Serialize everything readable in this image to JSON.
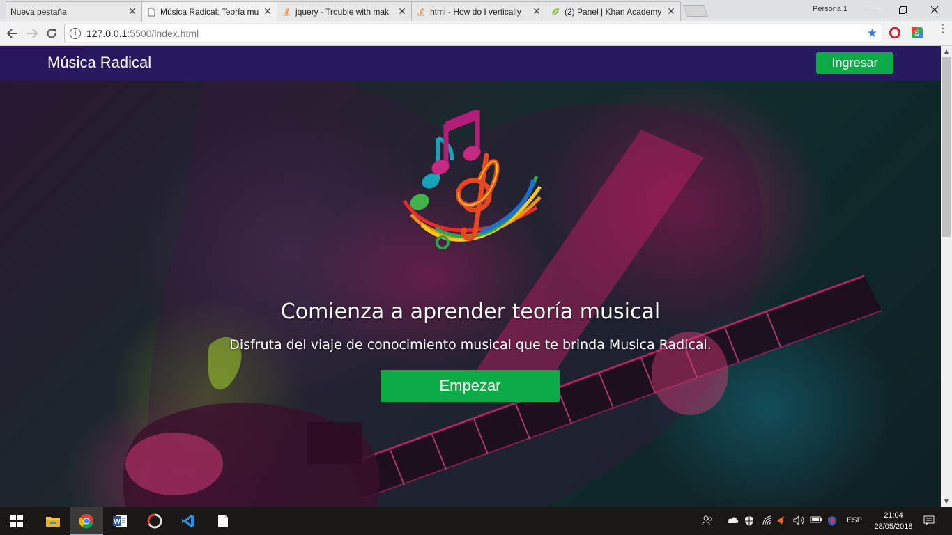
{
  "browser": {
    "tabs": [
      {
        "label": "Nueva pestaña",
        "favicon": "none"
      },
      {
        "label": "Música Radical: Teoría mu",
        "favicon": "page-icon"
      },
      {
        "label": "jquery - Trouble with mak",
        "favicon": "stackoverflow-icon"
      },
      {
        "label": "html - How do I vertically",
        "favicon": "stackoverflow-icon"
      },
      {
        "label": "(2) Panel | Khan Academy",
        "favicon": "khan-leaf-icon"
      }
    ],
    "profile": "Persona 1",
    "url_host": "127.0.0.1",
    "url_rest": ":5500/index.html"
  },
  "site": {
    "brand": "Música Radical",
    "login_label": "Ingresar",
    "hero_title": "Comienza a aprender teoría musical",
    "hero_subtitle": "Disfruta del viaje de conocimiento musical que te brinda Musica Radical.",
    "start_label": "Empezar"
  },
  "taskbar": {
    "apps": [
      "windows-start-icon",
      "file-explorer-icon",
      "chrome-icon",
      "word-icon",
      "app-icon",
      "vscode-icon",
      "notepad-icon"
    ],
    "language": "ESP",
    "time": "21:04",
    "date": "28/05/2018"
  },
  "colors": {
    "navbar": "#281864",
    "accent_green": "#0bab46",
    "star_blue": "#3b78e7"
  }
}
